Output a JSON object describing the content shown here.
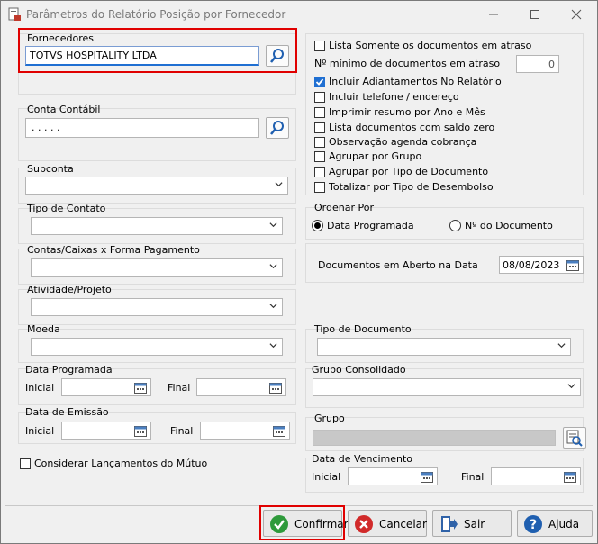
{
  "window": {
    "title": "Parâmetros do Relatório Posição por Fornecedor"
  },
  "fornecedores": {
    "label": "Fornecedores",
    "value": "TOTVS HOSPITALITY LTDA"
  },
  "conta_contabil": {
    "label": "Conta Contábil",
    "value": ". . . . ."
  },
  "subconta": {
    "label": "Subconta",
    "value": ""
  },
  "tipo_contato": {
    "label": "Tipo de Contato",
    "value": ""
  },
  "contas_caixas": {
    "label": "Contas/Caixas x Forma Pagamento",
    "value": ""
  },
  "atividade": {
    "label": "Atividade/Projeto",
    "value": ""
  },
  "moeda": {
    "label": "Moeda",
    "value": ""
  },
  "data_programada": {
    "label": "Data Programada",
    "inicial_label": "Inicial",
    "final_label": "Final",
    "inicial": "",
    "final": ""
  },
  "data_emissao": {
    "label": "Data de Emissão",
    "inicial_label": "Inicial",
    "final_label": "Final",
    "inicial": "",
    "final": ""
  },
  "considerar_mutuo": {
    "label": "Considerar Lançamentos do Mútuo",
    "checked": false
  },
  "options": {
    "lista_atraso": {
      "label": "Lista Somente os documentos em atraso",
      "checked": false
    },
    "num_min_label": "Nº mínimo de documentos em atraso",
    "num_min_value": "0",
    "items": [
      {
        "label": "Incluir Adiantamentos No Relatório",
        "checked": true
      },
      {
        "label": "Incluir telefone / endereço",
        "checked": false
      },
      {
        "label": "Imprimir resumo por Ano e Mês",
        "checked": false
      },
      {
        "label": "Lista documentos com saldo zero",
        "checked": false
      },
      {
        "label": "Observação agenda cobrança",
        "checked": false
      },
      {
        "label": "Agrupar por Grupo",
        "checked": false
      },
      {
        "label": "Agrupar por Tipo de Documento",
        "checked": false
      },
      {
        "label": "Totalizar por Tipo de Desembolso",
        "checked": false
      }
    ]
  },
  "ordenar": {
    "label": "Ordenar Por",
    "opt1": "Data Programada",
    "opt2": "Nº do Documento",
    "selected": "Data Programada"
  },
  "docs_aberto": {
    "label": "Documentos em Aberto na Data",
    "value": "08/08/2023"
  },
  "tipo_documento": {
    "label": "Tipo de Documento",
    "value": ""
  },
  "grupo_consolidado": {
    "label": "Grupo Consolidado",
    "value": ""
  },
  "grupo": {
    "label": "Grupo",
    "value": ""
  },
  "data_vencimento": {
    "label": "Data de Vencimento",
    "inicial_label": "Inicial",
    "final_label": "Final",
    "inicial": "",
    "final": ""
  },
  "buttons": {
    "confirmar": "Confirmar",
    "cancelar": "Cancelar",
    "sair": "Sair",
    "ajuda": "Ajuda"
  },
  "colors": {
    "accent": "#1f6fd2",
    "highlight": "#e00000",
    "confirm": "#2e9a3b",
    "cancel": "#d12a2a",
    "help": "#1f5fb0"
  }
}
